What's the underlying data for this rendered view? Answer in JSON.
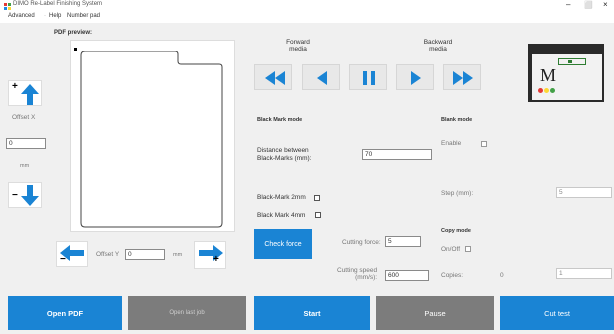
{
  "window": {
    "title": "DIMO Re-Label Finishing System",
    "controls": {
      "minimize": "–",
      "maximize": "⬜",
      "close": "×"
    }
  },
  "menu": {
    "items": [
      "Advanced",
      "Help",
      "Number pad"
    ]
  },
  "preview": {
    "label": "PDF preview:"
  },
  "offset_x": {
    "label": "Offset X",
    "value": "0",
    "unit": "mm"
  },
  "offset_y": {
    "label": "Offset Y",
    "value": "0",
    "unit": "mm"
  },
  "media": {
    "forward_label": "Forward\nmedia",
    "backward_label": "Backward\nmedia"
  },
  "black_mark_mode": {
    "heading": "Black Mark mode",
    "distance_label": "Distance between\nBlack-Marks (mm):",
    "distance_value": "70",
    "bm2mm_label": "Black-Mark 2mm",
    "bm4mm_label": "Black Mark 4mm"
  },
  "blank_mode": {
    "heading": "Blank mode",
    "enable_label": "Enable",
    "step_label": "Step (mm):",
    "step_value": "5"
  },
  "check_force": {
    "button": "Check force",
    "cutting_force_label": "Cutting force:",
    "cutting_force_value": "5",
    "cutting_speed_label": "Cutting speed\n(mm/s):",
    "cutting_speed_value": "600"
  },
  "copy_mode": {
    "heading": "Copy mode",
    "onoff_label": "On/Off",
    "copies_label": "Copies:",
    "copies_value": "0",
    "copies_field": "1"
  },
  "buttons": {
    "open_pdf": "Open PDF",
    "open_last_job": "Open last job",
    "start": "Start",
    "pause": "Pause",
    "cut_test": "Cut test"
  },
  "colors": {
    "accent_blue": "#1e88e5",
    "btn_blue": "#1a84d4",
    "btn_gray": "#7c7c7c",
    "arrow_blue": "#1a84d4"
  }
}
